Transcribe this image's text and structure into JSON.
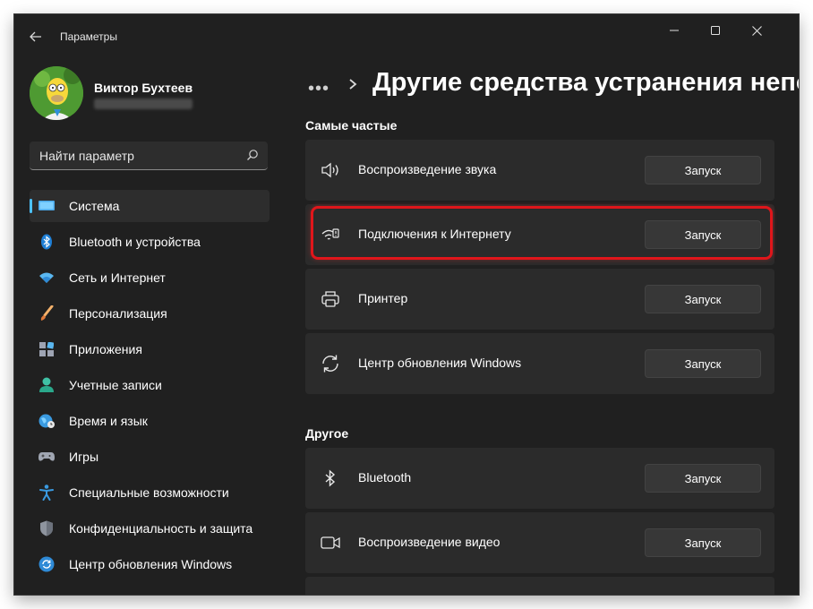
{
  "window": {
    "title": "Параметры",
    "controls": {
      "minimize_icon": "minimize-icon",
      "maximize_icon": "maximize-icon",
      "close_icon": "close-icon"
    }
  },
  "user": {
    "name": "Виктор Бухтеев",
    "email": ""
  },
  "search": {
    "placeholder": "Найти параметр",
    "icon": "search-icon"
  },
  "sidebar": {
    "accent": "#4cc2ff",
    "items": [
      {
        "label": "Система",
        "icon": "monitor-icon",
        "active": true
      },
      {
        "label": "Bluetooth и устройства",
        "icon": "bluetooth-icon"
      },
      {
        "label": "Сеть и Интернет",
        "icon": "wifi-icon"
      },
      {
        "label": "Персонализация",
        "icon": "brush-icon"
      },
      {
        "label": "Приложения",
        "icon": "apps-icon"
      },
      {
        "label": "Учетные записи",
        "icon": "person-icon"
      },
      {
        "label": "Время и язык",
        "icon": "globe-icon"
      },
      {
        "label": "Игры",
        "icon": "gamepad-icon"
      },
      {
        "label": "Специальные возможности",
        "icon": "accessibility-icon"
      },
      {
        "label": "Конфиденциальность и защита",
        "icon": "shield-icon"
      },
      {
        "label": "Центр обновления Windows",
        "icon": "update-icon"
      }
    ]
  },
  "breadcrumb": {
    "more": "•••",
    "title": "Другие средства устранения непола"
  },
  "sections": {
    "frequent": {
      "title": "Самые частые",
      "items": [
        {
          "label": "Воспроизведение звука",
          "icon": "speaker-icon",
          "button": "Запуск"
        },
        {
          "label": "Подключения к Интернету",
          "icon": "network-icon",
          "button": "Запуск",
          "highlighted": true
        },
        {
          "label": "Принтер",
          "icon": "printer-icon",
          "button": "Запуск"
        },
        {
          "label": "Центр обновления Windows",
          "icon": "sync-icon",
          "button": "Запуск"
        }
      ]
    },
    "other": {
      "title": "Другое",
      "items": [
        {
          "label": "Bluetooth",
          "icon": "bluetooth-icon",
          "button": "Запуск"
        },
        {
          "label": "Воспроизведение видео",
          "icon": "video-icon",
          "button": "Запуск"
        }
      ]
    }
  },
  "colors": {
    "highlight": "#e0161b",
    "background": "#202020",
    "card": "#2b2b2b"
  }
}
